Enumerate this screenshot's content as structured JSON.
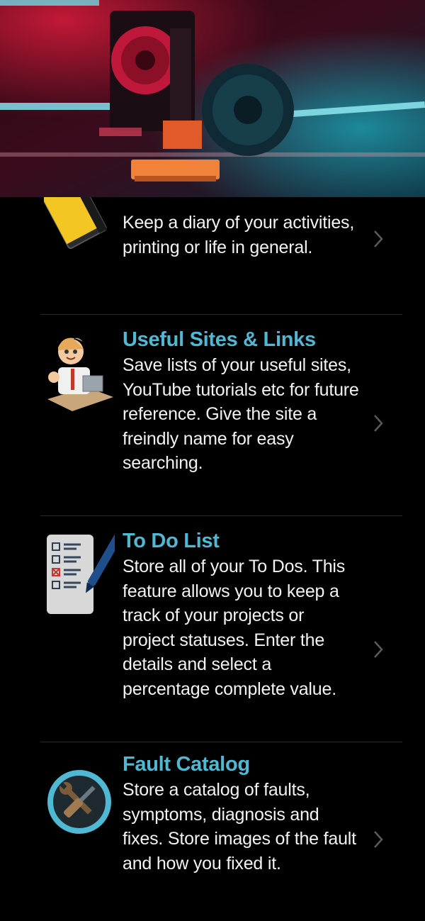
{
  "colors": {
    "background": "#000000",
    "title": "#4fb8d3",
    "text": "#f2f2f2",
    "chevron": "#5a5a5a",
    "divider": "#2a2a2a"
  },
  "hero": {
    "image": "3d-printer-photo",
    "description_icon": "printer-hero-image"
  },
  "features": [
    {
      "icon": "diary-notebook-icon",
      "title": "",
      "description": "Keep a diary of your activities, printing or life in general."
    },
    {
      "icon": "cartoon-man-laptop-icon",
      "title": "Useful Sites & Links",
      "description": "Save lists of your useful sites, YouTube tutorials etc for future reference. Give the site a freindly name for easy searching."
    },
    {
      "icon": "checklist-clipboard-icon",
      "title": "To Do List",
      "description": "Store all of your To Dos. This feature allows you to keep a track of your projects or project statuses. Enter the details and select a percentage complete value."
    },
    {
      "icon": "wrench-screwdriver-icon",
      "title": "Fault Catalog",
      "description": "Store a catalog of faults, symptoms, diagnosis and fixes. Store images of the fault and how you fixed it."
    }
  ]
}
